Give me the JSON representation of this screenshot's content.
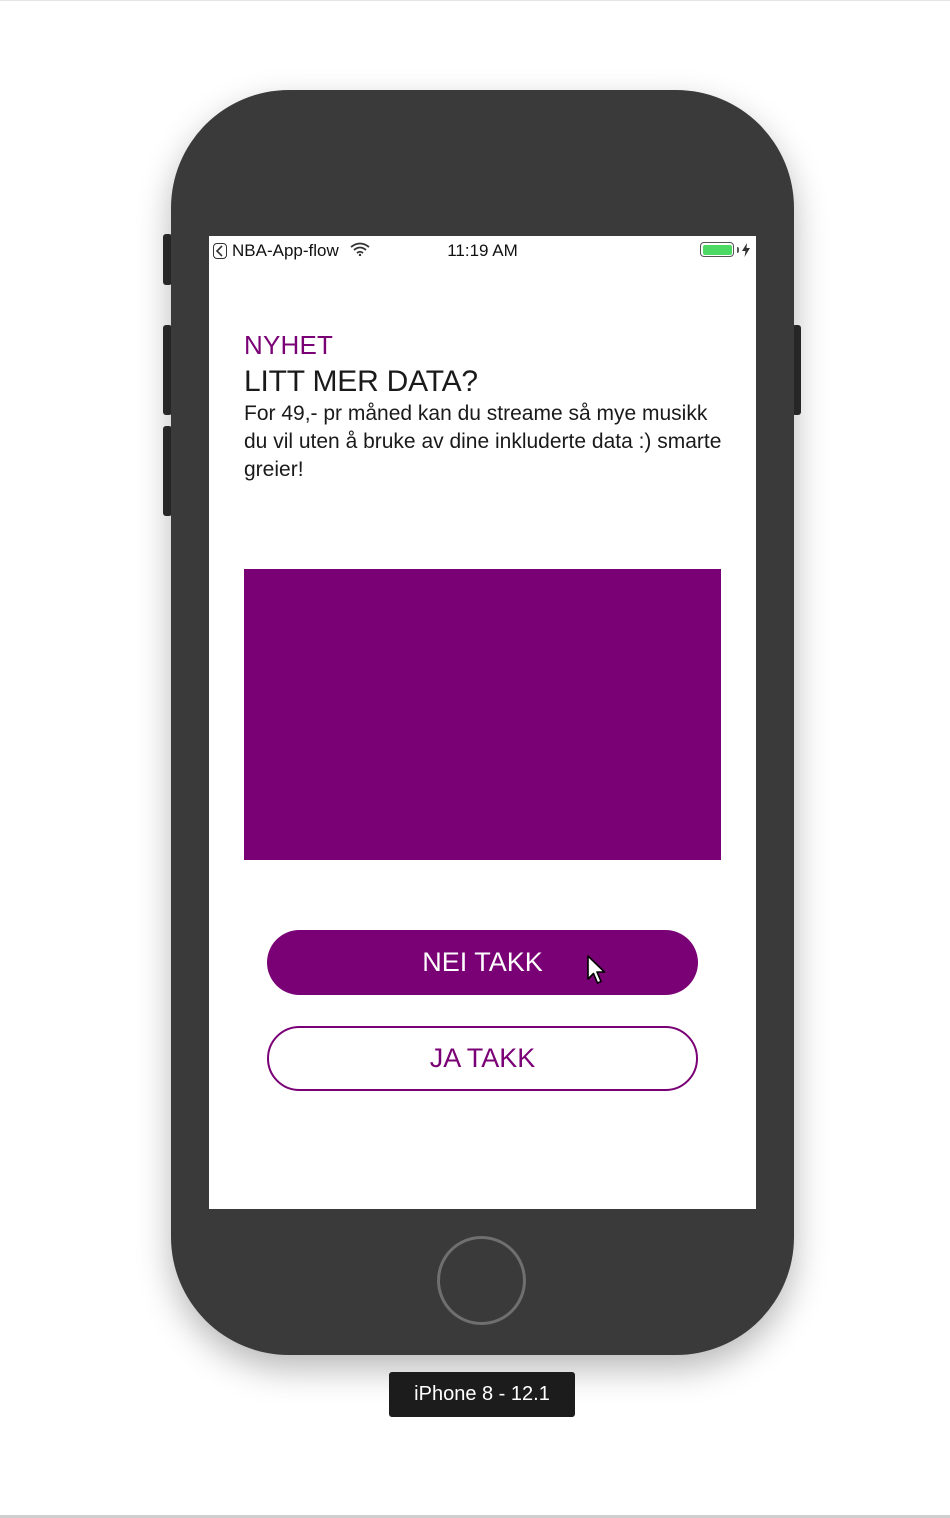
{
  "simulator": {
    "device_label": "iPhone 8 - 12.1"
  },
  "status_bar": {
    "app_name": "NBA-App-flow",
    "time": "11:19 AM",
    "battery_level": 1.0,
    "charging": true,
    "icons": [
      "back-app-icon",
      "wifi-icon",
      "battery-icon",
      "charging-bolt-icon"
    ]
  },
  "content": {
    "eyebrow": "NYHET",
    "headline": "LITT MER DATA?",
    "body": "For 49,- pr måned kan du streame så mye musikk du vil uten å bruke av dine inkluderte data :) smarte greier!"
  },
  "buttons": {
    "decline_label": "NEI TAKK",
    "accept_label": "JA TAKK"
  },
  "colors": {
    "accent": "#7a0075",
    "device_body": "#3a3a3a",
    "battery": "#4cd964"
  }
}
